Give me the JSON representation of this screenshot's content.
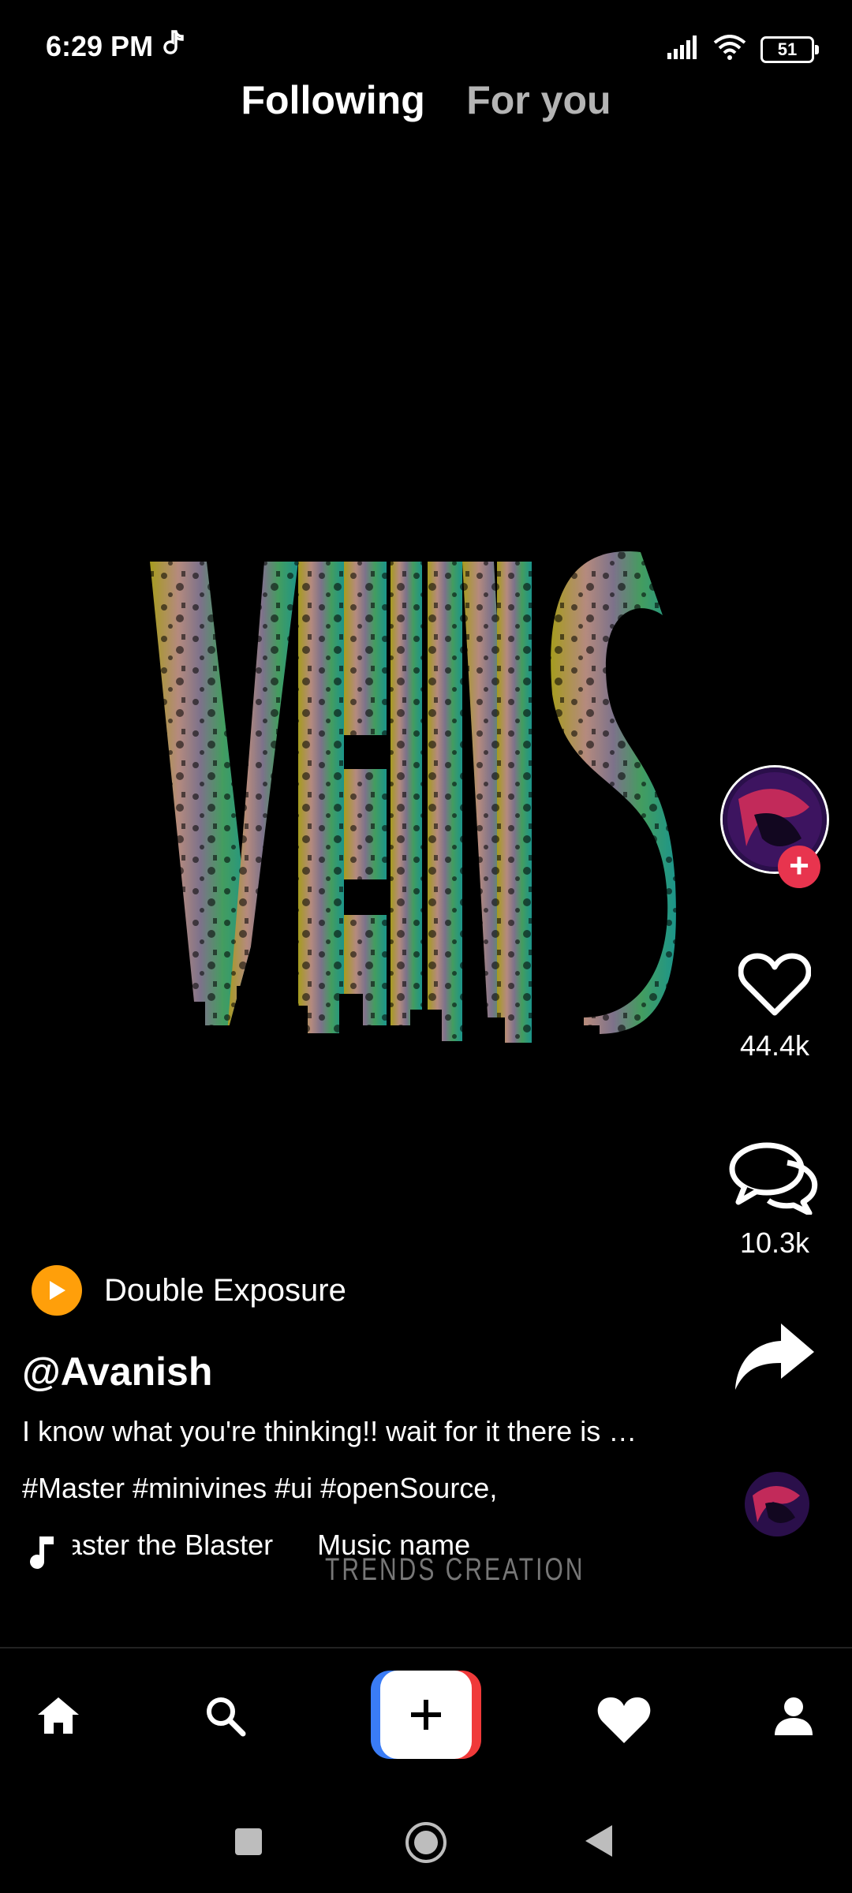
{
  "status_bar": {
    "time": "6:29 PM",
    "battery": "51",
    "icons": [
      "tiktok-note-icon",
      "signal-icon",
      "wifi-icon",
      "battery-icon"
    ]
  },
  "tabs": [
    {
      "label": "Following",
      "active": true
    },
    {
      "label": "For you",
      "active": false
    }
  ],
  "video": {
    "background": "#000000"
  },
  "rail": {
    "likes": "44.4k",
    "comments": "10.3k",
    "icons": [
      "heart-outline-icon",
      "comment-bubbles-icon",
      "share-arrow-icon"
    ]
  },
  "post": {
    "sound_title": "Double Exposure",
    "username": "@Avanish",
    "caption": "I know what you're thinking!! wait for it there is …",
    "hashtags": "#Master #minivines #ui #openSource,",
    "music_title": "Master the Blaster",
    "music_name": "Music name",
    "watermark": "TRENDS CREATION"
  },
  "bottom_nav": {
    "items": [
      "home-icon",
      "search-icon",
      "create-plus-icon",
      "heart-icon",
      "profile-icon"
    ]
  },
  "colors": {
    "accent_red": "#e8344e",
    "accent_orange": "#ff9f0a",
    "create_blue": "#3a7cf6",
    "create_red": "#f03a3a"
  }
}
